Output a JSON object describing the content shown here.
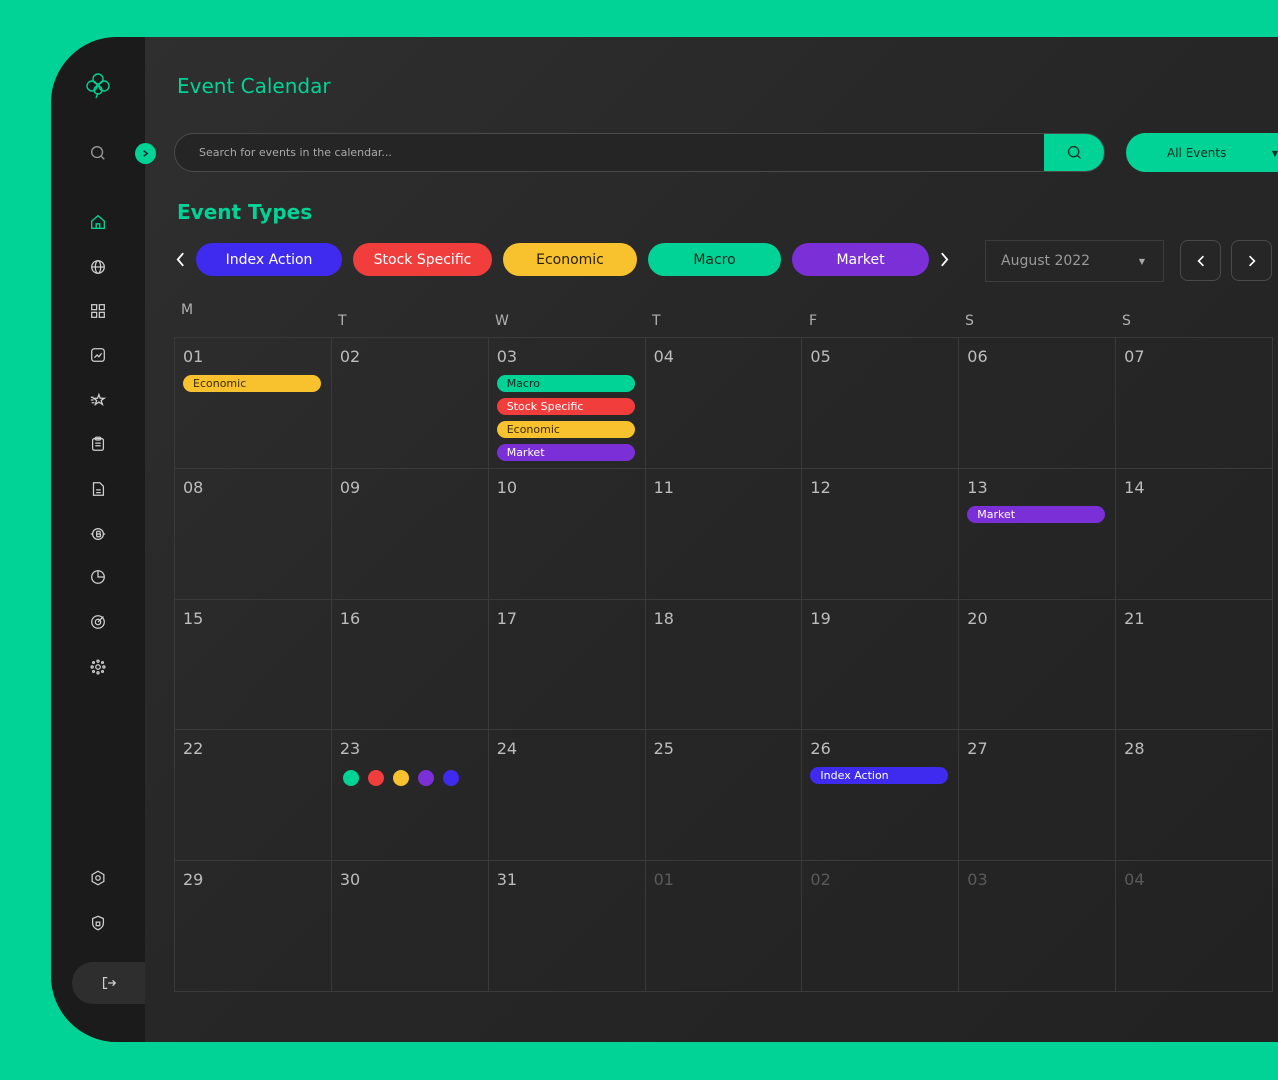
{
  "colors": {
    "accent": "#00d395",
    "index_action": "#3f2bf0",
    "stock_specific": "#f23d3d",
    "economic": "#f7c22e",
    "macro": "#00d395",
    "market": "#7b2fd6"
  },
  "sidebar": {
    "icons": [
      "logo-icon",
      "search-icon",
      "home-icon",
      "globe-icon",
      "grid-icon",
      "chart-icon",
      "stars-icon",
      "clipboard-icon",
      "document-icon",
      "bitcoin-icon",
      "pie-chart-icon",
      "target-icon",
      "network-icon",
      "settings-icon",
      "shield-icon",
      "logout-icon"
    ]
  },
  "header": {
    "title": "Event Calendar",
    "search_placeholder": "Search for events in the calendar...",
    "filter_label": "All Events"
  },
  "event_types": {
    "title": "Event Types",
    "items": [
      {
        "label": "Index Action"
      },
      {
        "label": "Stock Specific"
      },
      {
        "label": "Economic"
      },
      {
        "label": "Macro"
      },
      {
        "label": "Market"
      }
    ]
  },
  "calendar": {
    "month": "August 2022",
    "weekdays": [
      "M",
      "T",
      "W",
      "T",
      "F",
      "S",
      "S"
    ],
    "weeks": [
      [
        {
          "day": "01",
          "events": [
            "Economic"
          ]
        },
        {
          "day": "02",
          "events": []
        },
        {
          "day": "03",
          "events": [
            "Macro",
            "Stock Specific",
            "Economic",
            "Market"
          ]
        },
        {
          "day": "04",
          "events": []
        },
        {
          "day": "05",
          "events": []
        },
        {
          "day": "06",
          "events": []
        },
        {
          "day": "07",
          "events": []
        }
      ],
      [
        {
          "day": "08",
          "events": []
        },
        {
          "day": "09",
          "events": []
        },
        {
          "day": "10",
          "events": []
        },
        {
          "day": "11",
          "events": []
        },
        {
          "day": "12",
          "events": []
        },
        {
          "day": "13",
          "events": [
            "Market"
          ]
        },
        {
          "day": "14",
          "events": []
        }
      ],
      [
        {
          "day": "15",
          "events": []
        },
        {
          "day": "16",
          "events": []
        },
        {
          "day": "17",
          "events": []
        },
        {
          "day": "18",
          "events": []
        },
        {
          "day": "19",
          "events": []
        },
        {
          "day": "20",
          "events": []
        },
        {
          "day": "21",
          "events": []
        }
      ],
      [
        {
          "day": "22",
          "events": []
        },
        {
          "day": "23",
          "dots": [
            "Macro",
            "Stock Specific",
            "Economic",
            "Market",
            "Index Action"
          ]
        },
        {
          "day": "24",
          "events": []
        },
        {
          "day": "25",
          "events": []
        },
        {
          "day": "26",
          "events": [
            "Index Action"
          ]
        },
        {
          "day": "27",
          "events": []
        },
        {
          "day": "28",
          "events": []
        }
      ],
      [
        {
          "day": "29",
          "events": []
        },
        {
          "day": "30",
          "events": []
        },
        {
          "day": "31",
          "events": []
        },
        {
          "day": "01",
          "muted": true,
          "events": []
        },
        {
          "day": "02",
          "muted": true,
          "events": []
        },
        {
          "day": "03",
          "muted": true,
          "events": []
        },
        {
          "day": "04",
          "muted": true,
          "events": []
        }
      ]
    ]
  }
}
